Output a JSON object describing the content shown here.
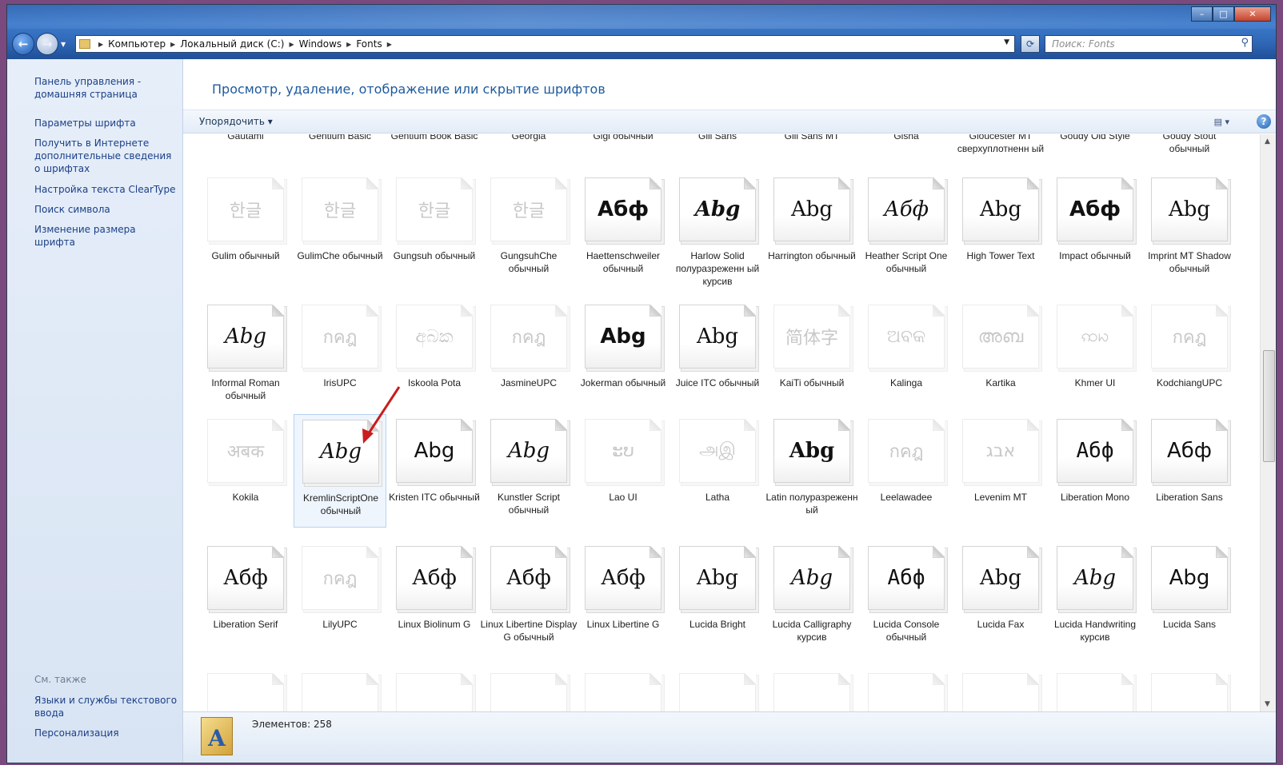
{
  "window": {
    "controls": [
      "–",
      "□",
      "✕"
    ]
  },
  "address": {
    "crumbs": [
      "Компьютер",
      "Локальный диск (C:)",
      "Windows",
      "Fonts"
    ],
    "search_placeholder": "Поиск: Fonts"
  },
  "sidebar": {
    "links": [
      "Панель управления - домашняя страница",
      "Параметры шрифта",
      "Получить в Интернете дополнительные сведения о шрифтах",
      "Настройка текста ClearType",
      "Поиск символа",
      "Изменение размера шрифта"
    ],
    "see_also": "См. также",
    "footer_links": [
      "Языки и службы текстового ввода",
      "Персонализация"
    ]
  },
  "main": {
    "heading": "Просмотр, удаление, отображение или скрытие шрифтов",
    "organize": "Упорядочить ▾",
    "status": "Элементов: 258",
    "top_row_labels": [
      "Gautami",
      "Gentium Basic",
      "Gentium Book Basic",
      "Georgia",
      "Gigi обычный",
      "Gill Sans",
      "Gill Sans MT",
      "Gisha",
      "Gloucester MT сверхуплотненн ый",
      "Goudy Old Style",
      "Goudy Stout обычный"
    ],
    "rows": [
      [
        {
          "label": "Gulim обычный",
          "glyph": "한글",
          "faded": true
        },
        {
          "label": "GulimChe обычный",
          "glyph": "한글",
          "faded": true
        },
        {
          "label": "Gungsuh обычный",
          "glyph": "한글",
          "faded": true
        },
        {
          "label": "GungsuhChe обычный",
          "glyph": "한글",
          "faded": true
        },
        {
          "label": "Haettenschweiler обычный",
          "glyph": "Абф",
          "style": "bold"
        },
        {
          "label": "Harlow Solid полуразреженн ый курсив",
          "glyph": "Abg",
          "style": "serif bold italic"
        },
        {
          "label": "Harrington обычный",
          "glyph": "Abg",
          "style": "serif"
        },
        {
          "label": "Heather Script One обычный",
          "glyph": "Абф",
          "style": "serif italic"
        },
        {
          "label": "High Tower Text",
          "glyph": "Abg",
          "style": "serif"
        },
        {
          "label": "Impact обычный",
          "glyph": "Абф",
          "style": "bold"
        },
        {
          "label": "Imprint MT Shadow обычный",
          "glyph": "Abg",
          "style": "serif"
        }
      ],
      [
        {
          "label": "Informal Roman обычный",
          "glyph": "Abg",
          "style": "serif italic"
        },
        {
          "label": "IrisUPC",
          "glyph": "กคฎ",
          "faded": true
        },
        {
          "label": "Iskoola Pota",
          "glyph": "අබක",
          "faded": true
        },
        {
          "label": "JasmineUPC",
          "glyph": "กคฎ",
          "faded": true
        },
        {
          "label": "Jokerman обычный",
          "glyph": "Abg",
          "style": "bold"
        },
        {
          "label": "Juice ITC обычный",
          "glyph": "Abg",
          "style": "serif"
        },
        {
          "label": "KaiTi обычный",
          "glyph": "简体字",
          "faded": true
        },
        {
          "label": "Kalinga",
          "glyph": "ଅବକ",
          "faded": true
        },
        {
          "label": "Kartika",
          "glyph": "അബ",
          "faded": true
        },
        {
          "label": "Khmer UI",
          "glyph": "ꩡꩢ",
          "faded": true
        },
        {
          "label": "KodchiangUPC",
          "glyph": "กคฎ",
          "faded": true
        }
      ],
      [
        {
          "label": "Kokila",
          "glyph": "अबक",
          "faded": true
        },
        {
          "label": "KremlinScriptOne обычный",
          "glyph": "Abg",
          "style": "serif italic",
          "selected": true
        },
        {
          "label": "Kristen ITC обычный",
          "glyph": "Abg"
        },
        {
          "label": "Kunstler Script обычный",
          "glyph": "Abg",
          "style": "serif italic"
        },
        {
          "label": "Lao UI",
          "glyph": "ະບ",
          "faded": true
        },
        {
          "label": "Latha",
          "glyph": "அஇ",
          "faded": true
        },
        {
          "label": "Latin полуразреженн ый",
          "glyph": "Abg",
          "style": "serif bold"
        },
        {
          "label": "Leelawadee",
          "glyph": "กคฎ",
          "faded": true
        },
        {
          "label": "Levenim MT",
          "glyph": "אבג",
          "faded": true
        },
        {
          "label": "Liberation Mono",
          "glyph": "Абф",
          "style": "mono"
        },
        {
          "label": "Liberation Sans",
          "glyph": "Абф"
        }
      ],
      [
        {
          "label": "Liberation Serif",
          "glyph": "Абф",
          "style": "serif"
        },
        {
          "label": "LilyUPC",
          "glyph": "กคฎ",
          "faded": true
        },
        {
          "label": "Linux Biolinum G",
          "glyph": "Абф",
          "style": "serif"
        },
        {
          "label": "Linux Libertine Display G обычный",
          "glyph": "Абф",
          "style": "serif"
        },
        {
          "label": "Linux Libertine G",
          "glyph": "Абф",
          "style": "serif"
        },
        {
          "label": "Lucida Bright",
          "glyph": "Abg",
          "style": "serif"
        },
        {
          "label": "Lucida Calligraphy курсив",
          "glyph": "Abg",
          "style": "serif italic"
        },
        {
          "label": "Lucida Console обычный",
          "glyph": "Абф",
          "style": "mono"
        },
        {
          "label": "Lucida Fax",
          "glyph": "Abg",
          "style": "serif"
        },
        {
          "label": "Lucida Handwriting курсив",
          "glyph": "Abg",
          "style": "serif italic"
        },
        {
          "label": "Lucida Sans",
          "glyph": "Abg"
        }
      ]
    ]
  }
}
